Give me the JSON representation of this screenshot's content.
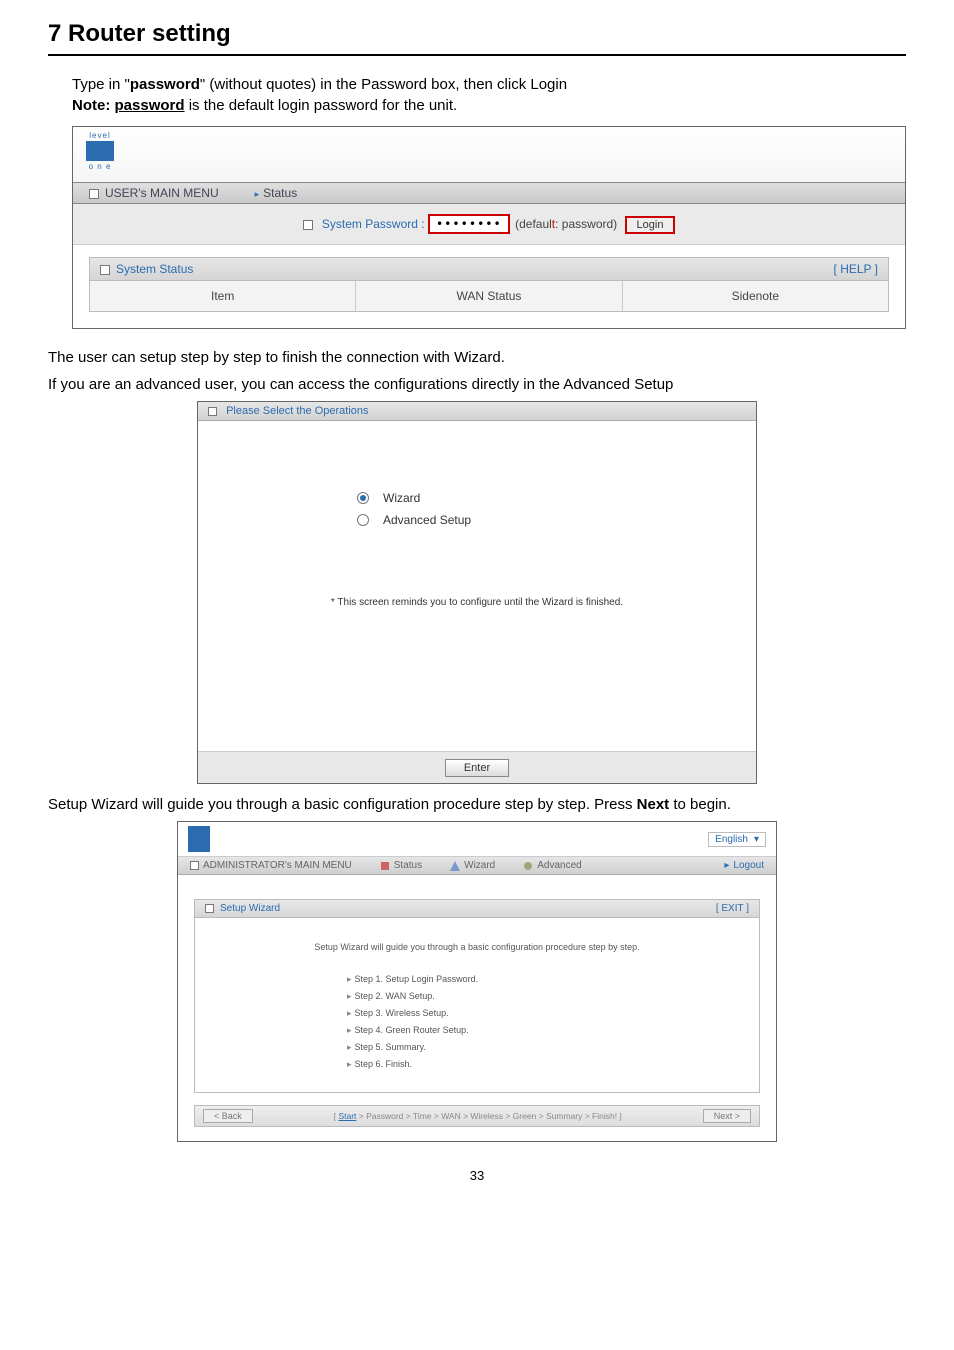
{
  "page": {
    "heading": "7   Router setting",
    "intro_line1_pre": "Type in \"",
    "intro_line1_pwd": "password",
    "intro_line1_post": "\" (without quotes) in the Password box, then click Login",
    "intro_line2_pre": "Note: ",
    "intro_line2_pwd": "password",
    "intro_line2_post": " is the default login password for the unit.",
    "between1": "The user can setup step by step to finish the connection with Wizard.",
    "between2": "If you are an advanced user, you can access the configurations directly in the Advanced Setup",
    "wizard_para_pre": "Setup Wizard will guide you through a basic configuration procedure step by step. Press ",
    "wizard_para_bold": "Next",
    "wizard_para_post": " to begin.",
    "page_number": "33"
  },
  "shot1": {
    "logo_top": "level",
    "logo_bottom": "o n e",
    "menu_user": "USER's MAIN MENU",
    "menu_status": "Status",
    "sys_pwd_label": "System Password :",
    "pwd_masked": "••••••••",
    "default_pre": "(defaul",
    "default_post": ": password)",
    "login": "Login",
    "sys_status": "System Status",
    "help": "[ HELP ]",
    "col_item": "Item",
    "col_wan": "WAN Status",
    "col_side": "Sidenote"
  },
  "shot2": {
    "header": "Please Select the Operations",
    "opt_wizard": "Wizard",
    "opt_adv": "Advanced Setup",
    "note": "* This screen reminds you to configure until the Wizard is finished.",
    "enter": "Enter"
  },
  "shot3": {
    "lang": "English",
    "menu_admin": "ADMINISTRATOR's MAIN MENU",
    "menu_status": "Status",
    "menu_wizard": "Wizard",
    "menu_adv": "Advanced",
    "menu_logout": "Logout",
    "panel_title": "Setup Wizard",
    "panel_exit": "[ EXIT ]",
    "panel_intro": "Setup Wizard will guide you through a basic configuration procedure step by step.",
    "steps": {
      "s1": "Step 1. Setup Login Password.",
      "s2": "Step 2. WAN Setup.",
      "s3": "Step 3. Wireless Setup.",
      "s4": "Step 4. Green Router Setup.",
      "s5": "Step 5. Summary.",
      "s6": "Step 6. Finish."
    },
    "foot_back": "< Back",
    "foot_trail_start": "Start",
    "foot_trail_rest": " > Password > Time > WAN > Wireless > Green > Summary > Finish! ]",
    "foot_trail_open": "[ ",
    "foot_next": "Next >"
  }
}
